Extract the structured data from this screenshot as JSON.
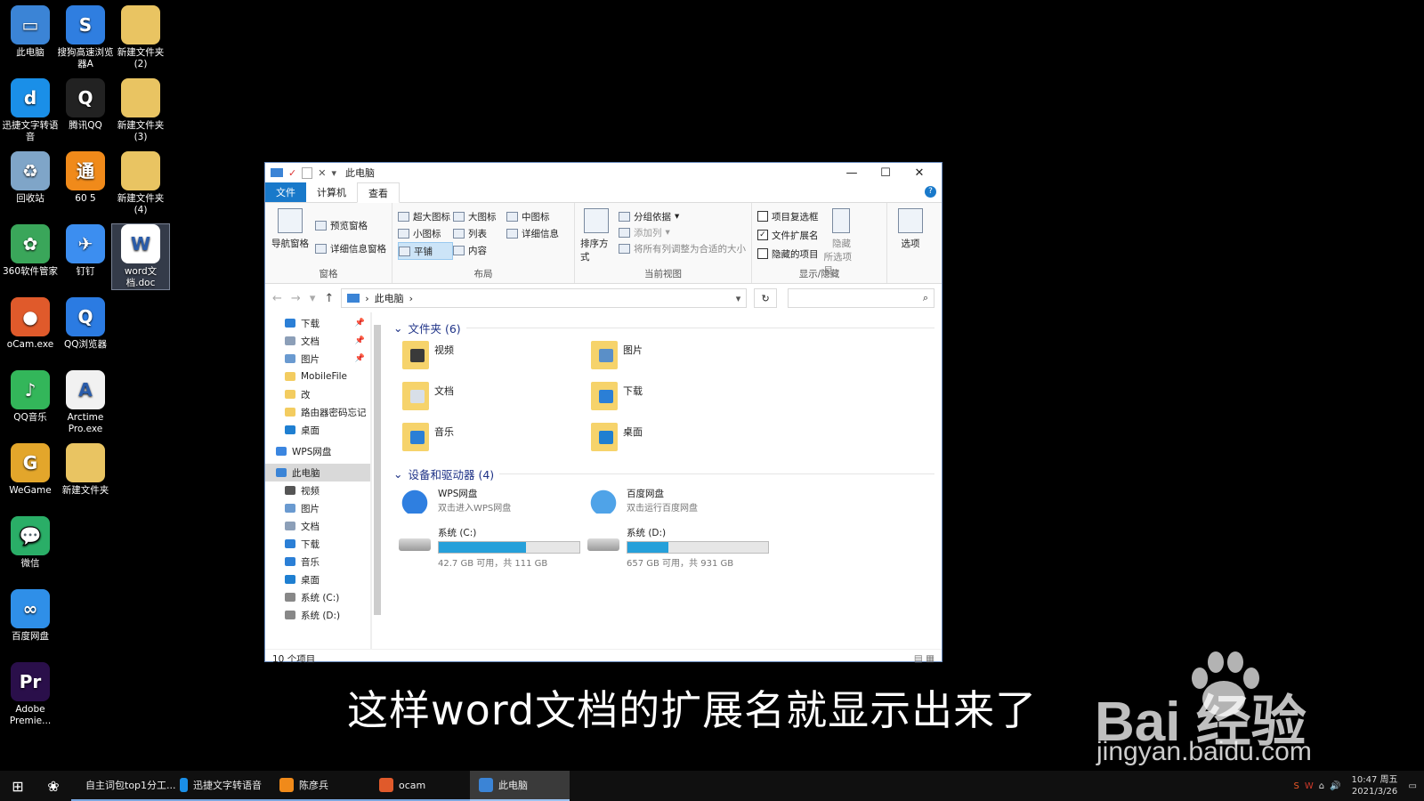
{
  "desktop": {
    "icons": [
      {
        "label": "此电脑",
        "glyph": "▭",
        "color": "#3b84d6"
      },
      {
        "label": "搜狗高速浏览器A",
        "glyph": "S",
        "color": "#2f7ee0"
      },
      {
        "label": "新建文件夹\n(2)",
        "glyph": "",
        "color": "#e9c462"
      },
      {
        "label": "迅捷文字转语音",
        "glyph": "d",
        "color": "#1a8fe8"
      },
      {
        "label": "腾讯QQ",
        "glyph": "Q",
        "color": "#222"
      },
      {
        "label": "新建文件夹\n(3)",
        "glyph": "",
        "color": "#e9c462"
      },
      {
        "label": "回收站",
        "glyph": "♻",
        "color": "#7fa5c8"
      },
      {
        "label": "60 5",
        "glyph": "通",
        "color": "#f08a1a"
      },
      {
        "label": "新建文件夹\n(4)",
        "glyph": "",
        "color": "#e9c462"
      },
      {
        "label": "360软件管家",
        "glyph": "✿",
        "color": "#3aa65a"
      },
      {
        "label": "钉钉",
        "glyph": "✈",
        "color": "#3c8ef0"
      },
      {
        "label": "word文档.doc",
        "glyph": "W",
        "color": "#ffffff"
      },
      {
        "label": "oCam.exe",
        "glyph": "●",
        "color": "#e05a2b"
      },
      {
        "label": "QQ浏览器",
        "glyph": "Q",
        "color": "#2b7be2"
      },
      {
        "label": "QQ音乐",
        "glyph": "♪",
        "color": "#33b65a"
      },
      {
        "label": "Arctime Pro.exe",
        "glyph": "A",
        "color": "#f1f1f1"
      },
      {
        "label": "WeGame",
        "glyph": "G",
        "color": "#e3a62b"
      },
      {
        "label": "新建文件夹",
        "glyph": "",
        "color": "#e9c462"
      },
      {
        "label": "微信",
        "glyph": "💬",
        "color": "#2aae67"
      },
      {
        "label": "百度网盘",
        "glyph": "∞",
        "color": "#2f8fe8"
      },
      {
        "label": "Adobe Premie...",
        "glyph": "Pr",
        "color": "#2a0f4a"
      }
    ]
  },
  "window": {
    "title": "此电脑",
    "tabs": [
      "文件",
      "计算机",
      "查看"
    ],
    "ribbon": {
      "pane": {
        "nav_pane": "导航窗格",
        "preview_pane": "预览窗格",
        "details_pane": "详细信息窗格",
        "label": "窗格"
      },
      "layout": {
        "items": [
          "超大图标",
          "大图标",
          "中图标",
          "小图标",
          "列表",
          "详细信息",
          "平铺",
          "内容"
        ],
        "label": "布局"
      },
      "current_view": {
        "sort": "排序方式",
        "group_by": "分组依据",
        "add_column": "添加列",
        "fit_columns": "将所有列调整为合适的大小",
        "label": "当前视图"
      },
      "show_hide": {
        "item_checkboxes": "项目复选框",
        "file_extensions": "文件扩展名",
        "hidden_items": "隐藏的项目",
        "hide": "隐藏",
        "selected_items": "所选项目",
        "label": "显示/隐藏",
        "file_extensions_checked": true
      },
      "options": "选项"
    },
    "address": {
      "path": "此电脑",
      "sep": "›"
    },
    "nav": [
      {
        "label": "下载",
        "color": "#2b7fd6",
        "pinned": true,
        "indent": true
      },
      {
        "label": "文档",
        "color": "#8c9fb8",
        "pinned": true,
        "indent": true
      },
      {
        "label": "图片",
        "color": "#6a9ad0",
        "pinned": true,
        "indent": true
      },
      {
        "label": "MobileFile",
        "color": "#f3cc60",
        "pinned": false,
        "indent": true
      },
      {
        "label": "改",
        "color": "#f3cc60",
        "pinned": false,
        "indent": true
      },
      {
        "label": "路由器密码忘记",
        "color": "#f3cc60",
        "pinned": false,
        "indent": true
      },
      {
        "label": "桌面",
        "color": "#1f7fd1",
        "pinned": false,
        "indent": true
      },
      {
        "label": "WPS网盘",
        "color": "#3b86e0",
        "pinned": false,
        "indent": false
      },
      {
        "label": "此电脑",
        "color": "#3b84d6",
        "pinned": false,
        "indent": false,
        "selected": true
      },
      {
        "label": "视频",
        "color": "#555",
        "pinned": false,
        "indent": true
      },
      {
        "label": "图片",
        "color": "#6a9ad0",
        "pinned": false,
        "indent": true
      },
      {
        "label": "文档",
        "color": "#8c9fb8",
        "pinned": false,
        "indent": true
      },
      {
        "label": "下载",
        "color": "#2b7fd6",
        "pinned": false,
        "indent": true
      },
      {
        "label": "音乐",
        "color": "#2b7fd6",
        "pinned": false,
        "indent": true
      },
      {
        "label": "桌面",
        "color": "#1f7fd1",
        "pinned": false,
        "indent": true
      },
      {
        "label": "系统 (C:)",
        "color": "#888",
        "pinned": false,
        "indent": true
      },
      {
        "label": "系统 (D:)",
        "color": "#888",
        "pinned": false,
        "indent": true
      }
    ],
    "folders_section": "文件夹 (6)",
    "folders": [
      {
        "label": "视频",
        "accent": "#3a3a3a"
      },
      {
        "label": "图片",
        "accent": "#5a8fc8"
      },
      {
        "label": "文档",
        "accent": "#d8dfe8"
      },
      {
        "label": "下载",
        "accent": "#2b7fd6"
      },
      {
        "label": "音乐",
        "accent": "#2b7fd6"
      },
      {
        "label": "桌面",
        "accent": "#1f7fd1"
      }
    ],
    "drives_section": "设备和驱动器 (4)",
    "drives": [
      {
        "name": "WPS网盘",
        "sub": "双击进入WPS网盘",
        "kind": "cloud",
        "color": "#2f7fe0"
      },
      {
        "name": "百度网盘",
        "sub": "双击运行百度网盘",
        "kind": "cloud",
        "color": "#4fa3e8"
      },
      {
        "name": "系统 (C:)",
        "sub": "42.7 GB 可用，共 111 GB",
        "kind": "disk",
        "used_fraction": 0.62
      },
      {
        "name": "系统 (D:)",
        "sub": "657 GB 可用，共 931 GB",
        "kind": "disk",
        "used_fraction": 0.29
      }
    ],
    "status": "10 个项目"
  },
  "caption": "这样word文档的扩展名就显示出来了",
  "watermark": {
    "brand": "Bai 经验",
    "url": "jingyan.baidu.com"
  },
  "taskbar": {
    "items": [
      {
        "label": "自主词包top1分工...",
        "color": "#d23a2b"
      },
      {
        "label": "迅捷文字转语音",
        "color": "#1a8fe8"
      },
      {
        "label": "陈彦兵",
        "color": "#f08a1a"
      },
      {
        "label": "ocam",
        "color": "#e05a2b"
      },
      {
        "label": "此电脑",
        "color": "#3b84d6",
        "active": true
      }
    ],
    "time": "10:47 周五",
    "date": "2021/3/26"
  }
}
